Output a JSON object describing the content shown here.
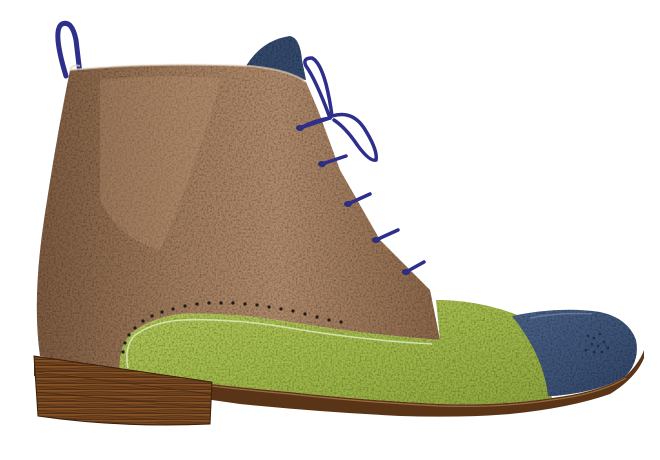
{
  "image": {
    "subject": "ankle-boot",
    "background_color": "#ffffff",
    "colors": {
      "quarter_leather": "#9a7658",
      "quarter_leather_light": "#b38d6e",
      "quarter_leather_dark": "#6f5038",
      "vamp_leather": "#a9c04e",
      "vamp_leather_light": "#c3d470",
      "vamp_leather_dark": "#7d9334",
      "toe_cap": "#3c5276",
      "toe_cap_light": "#566c93",
      "tongue": "#34496c",
      "laces": "#2e2f8a",
      "heel_wood": "#7a4a22",
      "heel_wood_dark": "#4e2c12",
      "sole_edge": "#5a3417",
      "welt": "#9a6a3a"
    },
    "parts": [
      "quarter",
      "vamp",
      "toe-cap",
      "tongue",
      "laces",
      "pull-loop",
      "heel",
      "sole",
      "brogue-perforations"
    ]
  }
}
